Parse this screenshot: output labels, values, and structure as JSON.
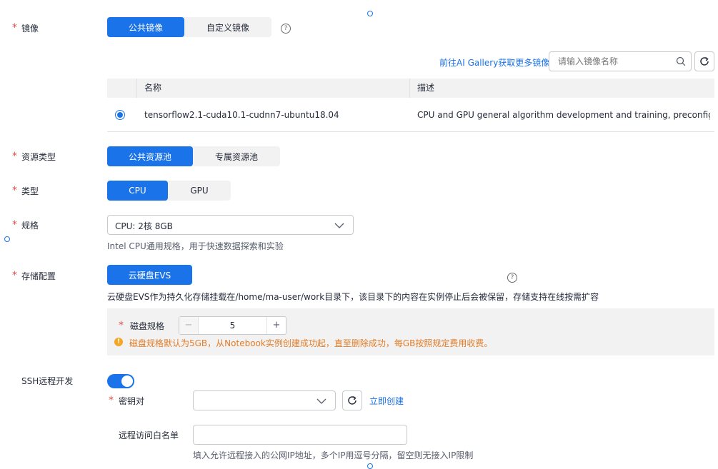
{
  "image": {
    "label": "镜像",
    "options": [
      "公共镜像",
      "自定义镜像"
    ],
    "gallery_link": "前往AI Gallery获取更多镜像",
    "search_placeholder": "请输入镜像名称",
    "table": {
      "headers": [
        "名称",
        "描述"
      ],
      "rows": [
        {
          "name": "tensorflow2.1-cuda10.1-cudnn7-ubuntu18.04",
          "description": "CPU and GPU general algorithm development and training, preconfigured..."
        }
      ]
    }
  },
  "resource_type": {
    "label": "资源类型",
    "options": [
      "公共资源池",
      "专属资源池"
    ]
  },
  "type": {
    "label": "类型",
    "options": [
      "CPU",
      "GPU"
    ]
  },
  "spec": {
    "label": "规格",
    "value": "CPU: 2核 8GB",
    "hint": "Intel CPU通用规格，用于快速数据探索和实验"
  },
  "storage": {
    "label": "存储配置",
    "option": "云硬盘EVS",
    "hint": "云硬盘EVS作为持久化存储挂载在/home/ma-user/work目录下，该目录下的内容在实例停止后会被保留，存储支持在线按需扩容",
    "disk_label": "磁盘规格",
    "disk_value": "5",
    "disk_minus": "−",
    "disk_plus": "+",
    "disk_warning": "磁盘规格默认为5GB，从Notebook实例创建成功起，直至删除成功，每GB按照规定费用收费。"
  },
  "ssh": {
    "label": "SSH远程开发",
    "keypair_label": "密钥对",
    "create_link": "立即创建",
    "whitelist_label": "远程访问白名单",
    "whitelist_hint": "填入允许远程接入的公网IP地址，多个IP用逗号分隔，留空则无接入IP限制"
  },
  "colors": {
    "accent": "#1a73e8",
    "required": "#e2504a",
    "warning": "#e37d29"
  }
}
